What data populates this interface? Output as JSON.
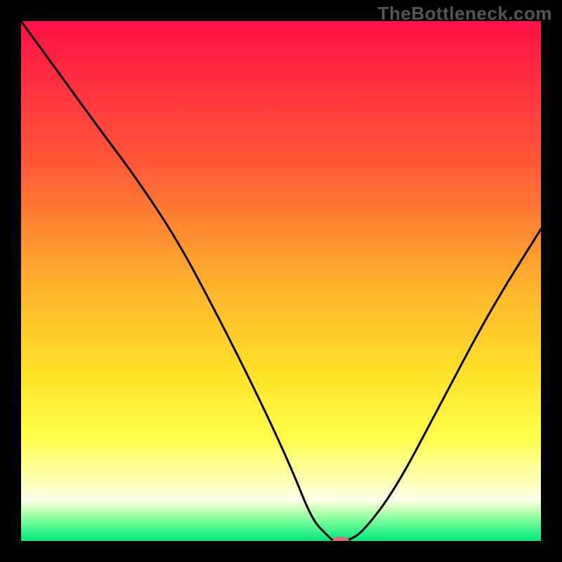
{
  "watermark": "TheBottleneck.com",
  "chart_data": {
    "type": "line",
    "title": "",
    "xlabel": "",
    "ylabel": "",
    "xlim": [
      0,
      100
    ],
    "ylim": [
      0,
      100
    ],
    "grid": false,
    "background_gradient_stops": [
      {
        "offset": 0.0,
        "color": "#ff1146"
      },
      {
        "offset": 0.28,
        "color": "#ff5a38"
      },
      {
        "offset": 0.5,
        "color": "#ffb02c"
      },
      {
        "offset": 0.68,
        "color": "#ffe22a"
      },
      {
        "offset": 0.8,
        "color": "#ffff4a"
      },
      {
        "offset": 0.88,
        "color": "#ffffb0"
      },
      {
        "offset": 0.92,
        "color": "#fdffe8"
      },
      {
        "offset": 0.94,
        "color": "#c8ffb8"
      },
      {
        "offset": 0.96,
        "color": "#7cff9c"
      },
      {
        "offset": 1.0,
        "color": "#00e77a"
      }
    ],
    "series": [
      {
        "name": "bottleneck-curve",
        "x": [
          0,
          8,
          16,
          22,
          30,
          38,
          46,
          52,
          56,
          59,
          60,
          63,
          66,
          72,
          80,
          90,
          100
        ],
        "y": [
          100,
          89,
          78,
          70,
          58,
          43,
          27,
          14,
          4,
          1,
          0,
          0,
          2,
          10,
          25,
          44,
          60
        ]
      }
    ],
    "marker": {
      "name": "selected-point",
      "x": 61.5,
      "y": 0,
      "color": "#e26a6a",
      "rx": 12,
      "ry": 6
    }
  }
}
